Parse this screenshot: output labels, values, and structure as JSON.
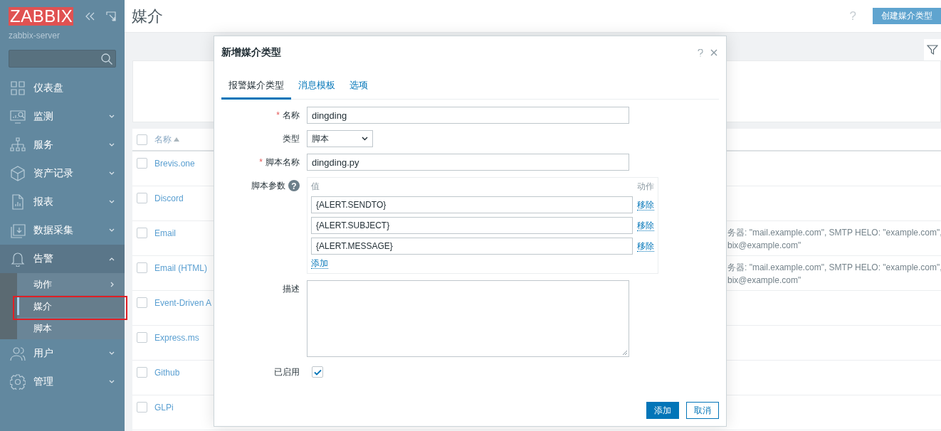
{
  "sidebar": {
    "logo": "ZABBIX",
    "server": "zabbix-server",
    "menu": [
      {
        "label": "仪表盘",
        "kind": "link",
        "expanded": false
      },
      {
        "label": "监测",
        "kind": "group",
        "expanded": false
      },
      {
        "label": "服务",
        "kind": "group",
        "expanded": false
      },
      {
        "label": "资产记录",
        "kind": "group",
        "expanded": false
      },
      {
        "label": "报表",
        "kind": "group",
        "expanded": false
      },
      {
        "label": "数据采集",
        "kind": "group",
        "expanded": false
      },
      {
        "label": "告警",
        "kind": "group",
        "expanded": true,
        "children": [
          {
            "label": "动作",
            "kind": "submenu",
            "selected": false
          },
          {
            "label": "媒介",
            "kind": "link",
            "selected": true
          },
          {
            "label": "脚本",
            "kind": "link",
            "selected": false
          }
        ]
      },
      {
        "label": "用户",
        "kind": "group",
        "expanded": false
      },
      {
        "label": "管理",
        "kind": "group",
        "expanded": false
      }
    ]
  },
  "page": {
    "title": "媒介",
    "help": "?",
    "create_button": "创建媒介类型"
  },
  "table": {
    "select_all_checked": false,
    "columns": [
      {
        "label": "名称",
        "sort_ascending": true
      }
    ],
    "rows": [
      {
        "name": "Brevis.one",
        "checked": false
      },
      {
        "name": "Discord",
        "checked": false
      },
      {
        "name": "Email",
        "checked": false,
        "details": [
          "务器: \"mail.example.com\", SMTP HELO: \"example.com\",",
          "bix@example.com\""
        ]
      },
      {
        "name": "Email (HTML)",
        "checked": false,
        "details": [
          "务器: \"mail.example.com\", SMTP HELO: \"example.com\",",
          "bix@example.com\""
        ]
      },
      {
        "name": "Event-Driven A",
        "checked": false
      },
      {
        "name": "Express.ms",
        "checked": false
      },
      {
        "name": "Github",
        "checked": false
      },
      {
        "name": "GLPi",
        "checked": false
      }
    ]
  },
  "dialog": {
    "title": "新增媒介类型",
    "tabs": [
      {
        "label": "报警媒介类型",
        "selected": true
      },
      {
        "label": "消息模板",
        "selected": false
      },
      {
        "label": "选项",
        "selected": false
      }
    ],
    "name": {
      "label": "名称",
      "required_mark": "*",
      "value": "dingding"
    },
    "type": {
      "label": "类型",
      "value": "脚本"
    },
    "script_name": {
      "label": "脚本名称",
      "required_mark": "*",
      "value": "dingding.py"
    },
    "params": {
      "label": "脚本参数",
      "help": "?",
      "value_header": "值",
      "action_header": "动作",
      "rows": [
        {
          "value": "{ALERT.SENDTO}",
          "action": "移除"
        },
        {
          "value": "{ALERT.SUBJECT}",
          "action": "移除"
        },
        {
          "value": "{ALERT.MESSAGE}",
          "action": "移除"
        }
      ],
      "add": "添加"
    },
    "description": {
      "label": "描述"
    },
    "enabled": {
      "label": "已启用",
      "checked": true
    },
    "buttons": [
      {
        "label": "添加",
        "kind": "primary"
      },
      {
        "label": "取消",
        "kind": "secondary"
      }
    ]
  }
}
